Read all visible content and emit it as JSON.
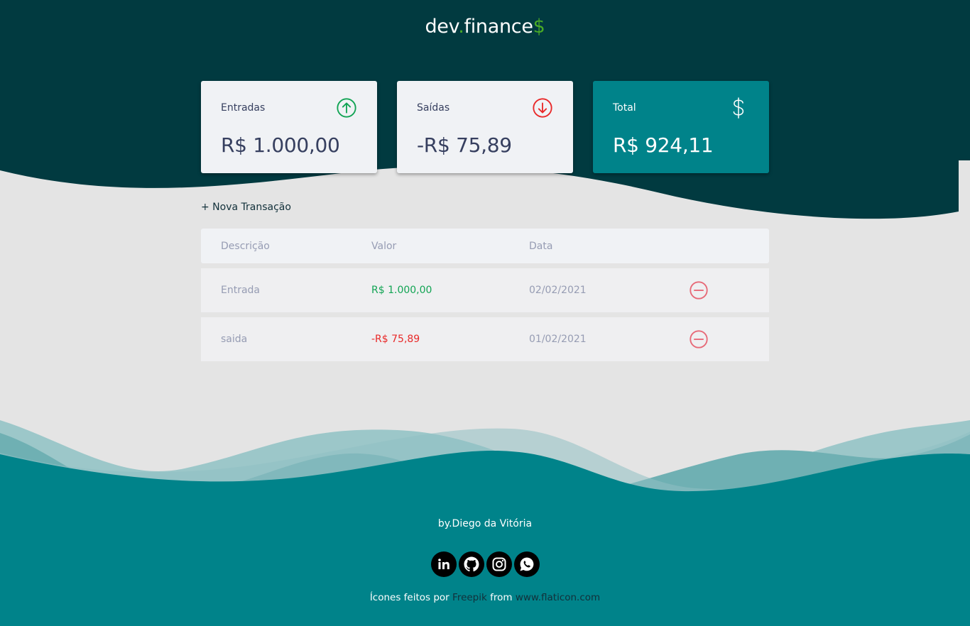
{
  "header": {
    "logo_dev": "dev",
    "logo_dot": ".",
    "logo_finance": "finance",
    "logo_dollar": "$"
  },
  "cards": [
    {
      "label": "Entradas",
      "value": "R$ 1.000,00",
      "icon": "arrow-up-circle-icon",
      "icon_color": "#12a454"
    },
    {
      "label": "Saídas",
      "value": "-R$ 75,89",
      "icon": "arrow-down-circle-icon",
      "icon_color": "#e92929"
    },
    {
      "label": "Total",
      "value": "R$ 924,11",
      "icon": "dollar-sign-icon",
      "icon_color": "#ffffff"
    }
  ],
  "new_transaction_label": "+ Nova Transação",
  "table": {
    "headers": [
      "Descrição",
      "Valor",
      "Data"
    ],
    "rows": [
      {
        "description": "Entrada",
        "amount": "R$ 1.000,00",
        "date": "02/02/2021",
        "type": "income"
      },
      {
        "description": "saida",
        "amount": "-R$ 75,89",
        "date": "01/02/2021",
        "type": "expense"
      }
    ]
  },
  "footer": {
    "author": "by.Diego da Vitória",
    "socials": [
      "linkedin-icon",
      "github-icon",
      "instagram-icon",
      "whatsapp-icon"
    ],
    "credits_prefix": "Ícones feitos por ",
    "credits_author": "Freepik",
    "credits_mid": " from ",
    "credits_site": "www.flaticon.com"
  },
  "colors": {
    "header_bg": "#013a40",
    "footer_bg": "#00838a",
    "page_bg": "#e4e4e4",
    "income": "#12a454",
    "expense": "#e92929",
    "card_bg": "#f0f2f5",
    "total_bg": "#00838a"
  }
}
